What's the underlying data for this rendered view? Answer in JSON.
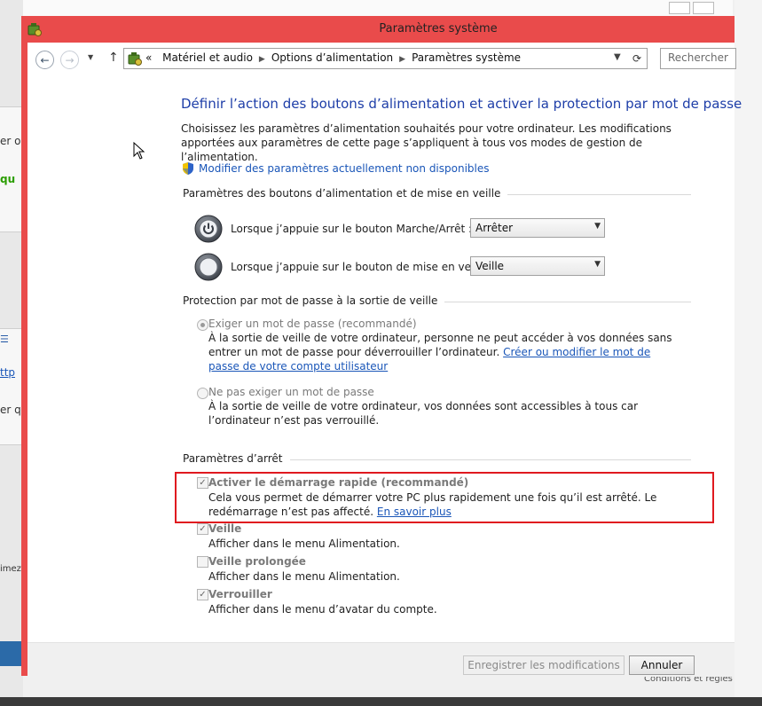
{
  "window": {
    "title": "Paramètres système",
    "icon": "power-options-icon"
  },
  "navigation": {
    "breadcrumb_prefix": "«",
    "breadcrumb": [
      "Matériel et audio",
      "Options d’alimentation",
      "Paramètres système"
    ],
    "search_placeholder": "Rechercher"
  },
  "page": {
    "heading": "Définir l’action des boutons d’alimentation et activer la protection par mot de passe",
    "description": "Choisissez les paramètres d’alimentation souhaités pour votre ordinateur. Les modifications apportées aux paramètres de cette page s’appliquent à tous vos modes de gestion de l’alimentation.",
    "change_unavailable_link": "Modifier des paramètres actuellement non disponibles"
  },
  "power_buttons": {
    "section_title": "Paramètres des boutons d’alimentation et de mise en veille",
    "rows": [
      {
        "label": "Lorsque j’appuie sur le bouton Marche/Arrêt :",
        "value": "Arrêter",
        "icon": "power-button-icon"
      },
      {
        "label": "Lorsque j’appuie sur le bouton de mise en veille :",
        "value": "Veille",
        "icon": "sleep-button-icon"
      }
    ]
  },
  "password": {
    "section_title": "Protection par mot de passe à la sortie de veille",
    "options": [
      {
        "title": "Exiger un mot de passe (recommandé)",
        "desc": "À la sortie de veille de votre ordinateur, personne ne peut accéder à vos données sans entrer un mot de passe pour déverrouiller l’ordinateur.",
        "link": "Créer ou modifier le mot de passe de votre compte utilisateur",
        "selected": true
      },
      {
        "title": "Ne pas exiger un mot de passe",
        "desc": "À la sortie de veille de votre ordinateur, vos données sont accessibles à tous car l’ordinateur n’est pas verrouillé.",
        "selected": false
      }
    ]
  },
  "shutdown": {
    "section_title": "Paramètres d’arrêt",
    "options": [
      {
        "title": "Activer le démarrage rapide (recommandé)",
        "desc": "Cela vous permet de démarrer votre PC plus rapidement une fois qu’il est arrêté. Le redémarrage n’est pas affecté.",
        "link": "En savoir plus",
        "checked": true
      },
      {
        "title": "Veille",
        "desc": "Afficher dans le menu Alimentation.",
        "checked": true
      },
      {
        "title": "Veille prolongée",
        "desc": "Afficher dans le menu Alimentation.",
        "checked": false
      },
      {
        "title": "Verrouiller",
        "desc": "Afficher dans le menu d’avatar du compte.",
        "checked": true
      }
    ]
  },
  "footer": {
    "save_label": "Enregistrer les modifications",
    "cancel_label": "Annuler"
  },
  "background": {
    "fragments": [
      "er o",
      "qu",
      "ttp",
      "er q",
      "imez"
    ],
    "bottom_right_text": "Conditions ...",
    "resize_glyph": "↔"
  },
  "colors": {
    "window_frame": "#e94b4b",
    "highlight_box": "#e0191f",
    "heading_blue": "#1e3ea8",
    "link_blue": "#1a56b8"
  }
}
